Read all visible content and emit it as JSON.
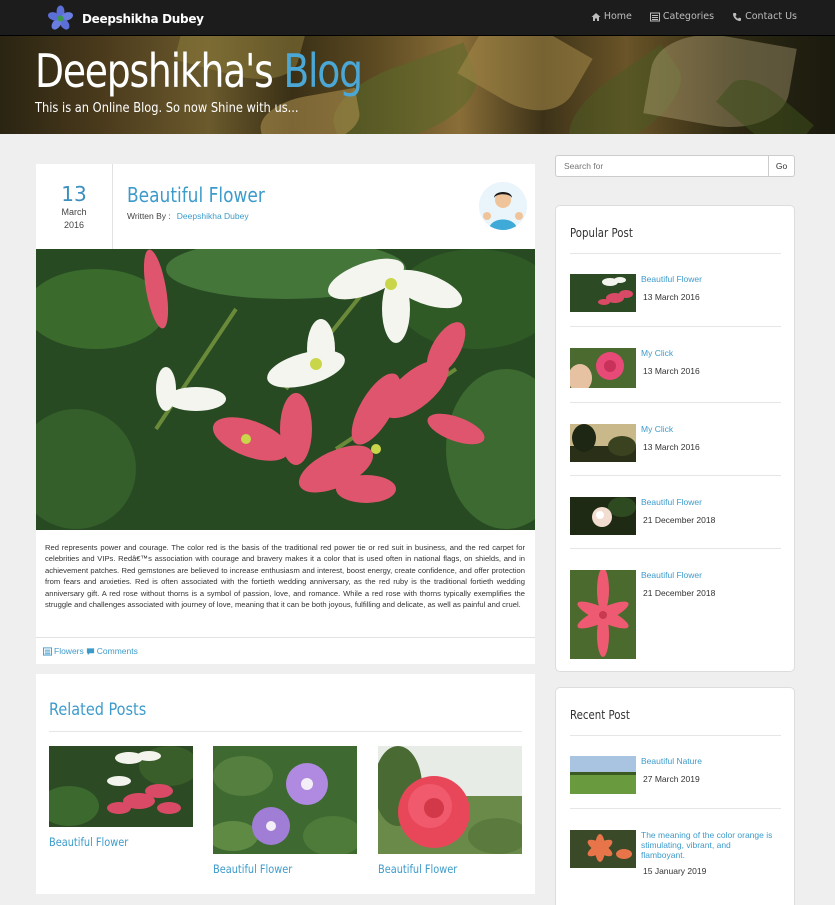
{
  "navbar": {
    "brand": "Deepshikha Dubey",
    "links": [
      {
        "label": "Home",
        "icon": "home-icon"
      },
      {
        "label": "Categories",
        "icon": "list-icon"
      },
      {
        "label": "Contact Us",
        "icon": "phone-icon"
      }
    ]
  },
  "hero": {
    "title_main": "Deepshikha's",
    "title_accent": "Blog",
    "tagline": "This is an Online Blog. So now Shine with us..."
  },
  "post": {
    "day": "13",
    "month": "March",
    "year": "2016",
    "title": "Beautiful Flower",
    "written_by": "Written By :",
    "author": "Deepshikha Dubey",
    "body": "Red represents power and courage. The color red is the basis of the traditional red power tie or red suit in business, and the red carpet for celebrities and VIPs. Redâ€™s association with courage and bravery makes it a color that is used often in national flags, on shields, and in achievement patches. Red gemstones are believed to increase enthusiasm and interest, boost energy, create confidence, and offer protection from fears and anxieties. Red is often associated with the fortieth wedding anniversary, as the red ruby is the traditional fortieth wedding anniversary gift. A red rose without thorns is a symbol of passion, love, and romance. While a red rose with thorns typically exemplifies the struggle and challenges associated with journey of love, meaning that it can be both joyous, fulfilling and delicate, as well as painful and cruel.",
    "category": "Flowers",
    "comments": "Comments"
  },
  "related": {
    "title": "Related Posts",
    "items": [
      {
        "label": "Beautiful Flower"
      },
      {
        "label": "Beautiful Flower"
      },
      {
        "label": "Beautiful Flower"
      }
    ]
  },
  "search": {
    "placeholder": "Search for",
    "button": "Go"
  },
  "popular": {
    "title": "Popular Post",
    "items": [
      {
        "title": "Beautiful Flower",
        "date": "13 March 2016"
      },
      {
        "title": "My Click",
        "date": "13 March 2016"
      },
      {
        "title": "My Click",
        "date": "13 March 2016"
      },
      {
        "title": "Beautiful Flower",
        "date": "21 December 2018"
      },
      {
        "title": "Beautiful Flower",
        "date": "21 December 2018"
      }
    ]
  },
  "recent": {
    "title": "Recent Post",
    "items": [
      {
        "title": "Beautiful Nature",
        "date": "27 March 2019"
      },
      {
        "title": "The meaning of the color orange is stimulating, vibrant, and flamboyant.",
        "date": "15 January 2019"
      }
    ]
  },
  "colors": {
    "accent": "#3d9bcb",
    "navbar": "#1c1c1c",
    "page_bg": "#efefef"
  }
}
